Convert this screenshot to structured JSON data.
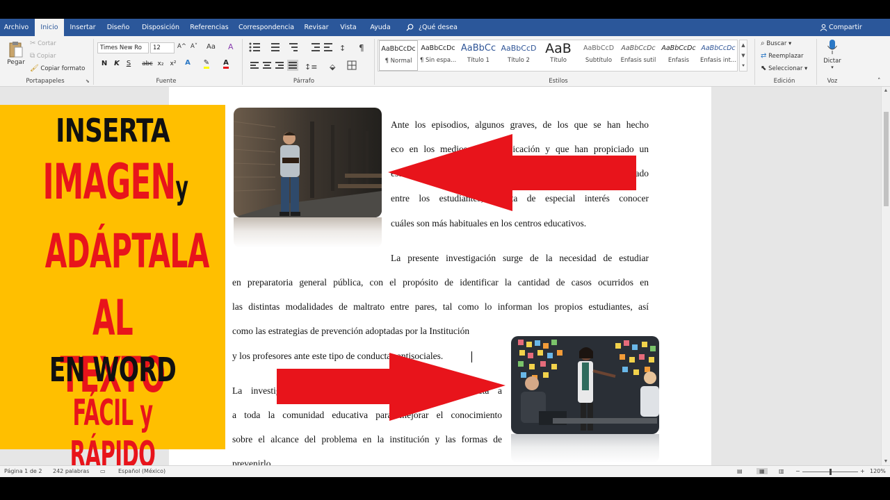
{
  "tabs": [
    {
      "label": "Archivo"
    },
    {
      "label": "Inicio"
    },
    {
      "label": "Insertar"
    },
    {
      "label": "Diseño"
    },
    {
      "label": "Disposición"
    },
    {
      "label": "Referencias"
    },
    {
      "label": "Correspondencia"
    },
    {
      "label": "Revisar"
    },
    {
      "label": "Vista"
    },
    {
      "label": "Ayuda"
    }
  ],
  "tell_me": "¿Qué desea hacer?",
  "share": "Compartir",
  "clipboard": {
    "paste": "Pegar",
    "cut": "Cortar",
    "copy": "Copiar",
    "format_painter": "Copiar formato",
    "group_label": "Portapapeles"
  },
  "font": {
    "name": "Times New Ro",
    "size": "12",
    "bold": "N",
    "italic": "K",
    "underline": "S",
    "strike": "abc",
    "sub": "x₂",
    "sup": "x²",
    "grow": "A^",
    "shrink": "A˅",
    "case": "Aa",
    "group_label": "Fuente"
  },
  "paragraph": {
    "group_label": "Párrafo"
  },
  "styles": {
    "group_label": "Estilos",
    "items": [
      {
        "preview": "AaBbCcDc",
        "name": "¶ Normal"
      },
      {
        "preview": "AaBbCcDc",
        "name": "¶ Sin espa..."
      },
      {
        "preview": "AaBbCc",
        "name": "Título 1"
      },
      {
        "preview": "AaBbCcD",
        "name": "Título 2"
      },
      {
        "preview": "AaB",
        "name": "Título"
      },
      {
        "preview": "AaBbCcD",
        "name": "Subtítulo"
      },
      {
        "preview": "AaBbCcDc",
        "name": "Énfasis sutil"
      },
      {
        "preview": "AaBbCcDc",
        "name": "Énfasis"
      },
      {
        "preview": "AaBbCcDc",
        "name": "Énfasis int..."
      }
    ]
  },
  "editing": {
    "find": "Buscar",
    "replace": "Reemplazar",
    "select": "Seleccionar",
    "group_label": "Edición"
  },
  "voice": {
    "dictate": "Dictar",
    "group_label": "Voz"
  },
  "banner": {
    "line1": "INSERTA",
    "line2a": "IMAGEN",
    "line2b": "y",
    "line3": "ADÁPTALA",
    "line4": "AL TEXTO",
    "line5": "EN WORD",
    "line6": "FÁCIL y RÁPIDO"
  },
  "document": {
    "p1": [
      "Ante los episodios, algunos graves, de los que se han hecho",
      "eco en los medios de comunicación y que han propiciado un",
      "estado de preocupación por el maltrato escolar observado",
      "entre los estudiantes, resulta de especial interés conocer",
      "cuáles son más habituales en los centros educativos."
    ],
    "p2_first": "La presente investigación surge de la necesidad de estudiar",
    "p2": [
      "en preparatoria general pública, con el propósito de identificar la cantidad de casos ocurridos en",
      "las distintas modalidades de maltrato entre pares, tal como lo informan los propios estudiantes, así"
    ],
    "p2_narrow": [
      "como las estrategias de prevención adoptadas por la Institución",
      "y los profesores ante este tipo de conductas antisociales."
    ],
    "p3": [
      "La investigación beneficiará de forma directa e indirecta a",
      "a toda la comunidad educativa para mejorar el conocimiento",
      "sobre el alcance del problema en la institución y las formas de",
      "prevenirlo."
    ]
  },
  "status": {
    "page": "Página 1 de 2",
    "words": "242 palabras",
    "language": "Español (México)",
    "zoom": "120%",
    "zoom_minus": "−",
    "zoom_plus": "+"
  },
  "colors": {
    "tabbar": "#2b579a",
    "banner_bg": "#ffbf00",
    "banner_red": "#e8141b",
    "banner_black": "#111111",
    "arrow_red": "#e8141b"
  }
}
